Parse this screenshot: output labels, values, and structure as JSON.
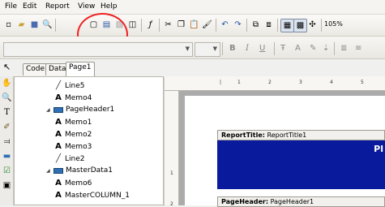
{
  "menu": [
    "File",
    "Edit",
    "Report",
    "View",
    "Help"
  ],
  "toolbar": {
    "zoom": "105%"
  },
  "format": {
    "bold": "B",
    "italic": "I",
    "underline": "U"
  },
  "tabs": [
    "Code",
    "Data",
    "Page1"
  ],
  "tree": {
    "nodes": [
      {
        "label": "Line5",
        "kind": "line",
        "depth": 2
      },
      {
        "label": "Memo4",
        "kind": "memo",
        "depth": 2
      },
      {
        "label": "PageHeader1",
        "kind": "band",
        "depth": 1
      },
      {
        "label": "Memo1",
        "kind": "memo",
        "depth": 2
      },
      {
        "label": "Memo2",
        "kind": "memo",
        "depth": 2
      },
      {
        "label": "Memo3",
        "kind": "memo",
        "depth": 2
      },
      {
        "label": "Line2",
        "kind": "line",
        "depth": 2
      },
      {
        "label": "MasterData1",
        "kind": "band",
        "depth": 1
      },
      {
        "label": "Memo6",
        "kind": "memo",
        "depth": 2
      },
      {
        "label": "MasterCOLUMN_1",
        "kind": "memo",
        "depth": 2
      }
    ]
  },
  "ruler": {
    "top": [
      "1",
      "2",
      "3",
      "4",
      "5"
    ],
    "left": [
      "1",
      "2"
    ]
  },
  "bands": {
    "report_title": {
      "label": "ReportTitle:",
      "name": "ReportTitle1",
      "preview": "Pl"
    },
    "page_header": {
      "label": "PageHeader:",
      "name": "PageHeader1"
    }
  },
  "colors": {
    "band_fill": "#0a1a9c",
    "highlight_circle": "#e22222"
  }
}
